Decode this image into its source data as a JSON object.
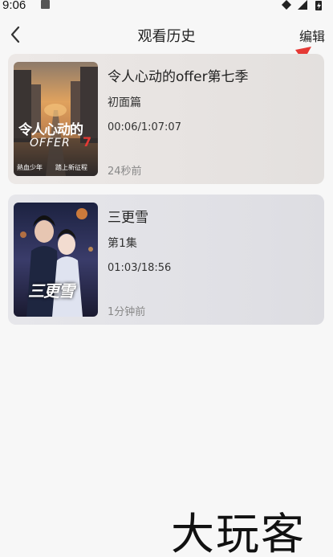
{
  "status_bar": {
    "time": "9:06"
  },
  "header": {
    "title": "观看历史",
    "edit_label": "编辑"
  },
  "history": [
    {
      "name": "令人心动的offer第七季",
      "episode": "初面篇",
      "progress": "00:06/1:07:07",
      "watched": "24秒前",
      "poster": {
        "title_text": "令人心动的",
        "sub_text": "OFFER",
        "tag_left": "熱血少年",
        "tag_right": "踏上新征程"
      }
    },
    {
      "name": "三更雪",
      "episode": "第1集",
      "progress": "01:03/18:56",
      "watched": "1分钟前",
      "poster": {
        "title_text": "三更雪"
      }
    }
  ],
  "watermark": "大玩客",
  "colors": {
    "arrow": "#e53935",
    "background": "#f7f7f7"
  }
}
